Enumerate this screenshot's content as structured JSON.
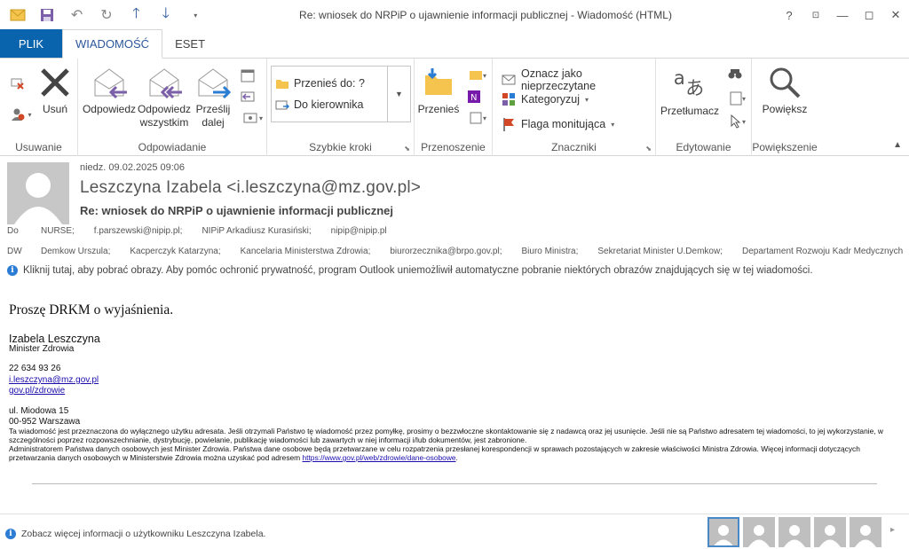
{
  "window": {
    "title": "Re: wniosek do NRPiP o ujawnienie informacji publicznej - Wiadomość (HTML)",
    "help": "?",
    "controls": {
      "minimize": "—",
      "restore": "◻",
      "close": "✕"
    }
  },
  "tabs": [
    {
      "label": "PLIK"
    },
    {
      "label": "WIADOMOŚĆ"
    },
    {
      "label": "ESET"
    }
  ],
  "ribbon": {
    "groups": {
      "delete": {
        "label": "Usuwanie",
        "delete_btn": "Usuń"
      },
      "respond": {
        "label": "Odpowiadanie",
        "reply": "Odpowiedz",
        "reply_all": "Odpowiedz wszystkim",
        "forward": "Prześlij dalej"
      },
      "quick_steps": {
        "label": "Szybkie kroki",
        "item1": "Przenieś do: ?",
        "item2": "Do kierownika"
      },
      "move": {
        "label": "Przenoszenie",
        "move_btn": "Przenieś"
      },
      "tags": {
        "label": "Znaczniki",
        "mark_unread": "Oznacz jako nieprzeczytane",
        "categorize": "Kategoryzuj",
        "follow_up": "Flaga monitująca"
      },
      "editing": {
        "label": "Edytowanie",
        "translate": "Przetłumacz"
      },
      "zoom": {
        "label": "Powiększenie",
        "zoom_btn": "Powiększ"
      }
    }
  },
  "message": {
    "date": "niedz. 09.02.2025 09:06",
    "sender": "Leszczyna Izabela <i.leszczyna@mz.gov.pl>",
    "subject": "Re: wniosek do NRPiP o ujawnienie informacji publicznej",
    "to_label": "Do",
    "to": [
      "NURSE;",
      "f.parszewski@nipip.pl;",
      "NIPiP Arkadiusz Kurasiński;",
      "nipip@nipip.pl"
    ],
    "cc_label": "DW",
    "cc": [
      "Demkow Urszula;",
      "Kacperczyk Katarzyna;",
      "Kancelaria Ministerstwa Zdrowia;",
      "biurorzecznika@brpo.gov.pl;",
      "Biuro Ministra;",
      "Sekretariat Minister U.Demkow;",
      "Departament Rozwoju Kadr Medycznych"
    ],
    "info_bar": "Kliknij tutaj, aby pobrać obrazy. Aby pomóc ochronić prywatność, program Outlook uniemożliwił automatyczne pobranie niektórych obrazów znajdujących się w tej wiadomości."
  },
  "body": {
    "greeting": "Proszę DRKM o wyjaśnienia.",
    "sig_name": "Izabela Leszczyna",
    "sig_role": "Minister Zdrowia",
    "sig_phone": "22 634 93 26",
    "sig_email": "i.leszczyna@mz.gov.pl",
    "sig_web": "gov.pl/zdrowie",
    "sig_addr1": "ul. Miodowa 15",
    "sig_addr2": "00-952 Warszawa",
    "disclaimer1": "Ta wiadomość jest przeznaczona do wyłącznego użytku adresata. Jeśli otrzymali Państwo tę wiadomość przez pomyłkę, prosimy o bezzwłoczne skontaktowanie się z nadawcą oraz jej usunięcie. Jeśli nie są Państwo adresatem tej wiadomości, to jej wykorzystanie, w szczególności poprzez rozpowszechnianie, dystrybucję, powielanie, publikację wiadomości lub zawartych w niej informacji i/lub dokumentów, jest zabronione.",
    "disclaimer2": "Administratorem Państwa danych osobowych jest Minister Zdrowia. Państwa dane osobowe będą przetwarzane w celu rozpatrzenia przesłanej korespondencji w sprawach pozostających w zakresie właściwości Ministra Zdrowia. Więcej informacji dotyczących przetwarzania danych osobowych w Ministerstwie Zdrowia można uzyskać pod adresem",
    "disclaimer_link": "https://www.gov.pl/web/zdrowie/dane-osobowe",
    "disclaimer_end": "."
  },
  "status": {
    "text": "Zobacz więcej informacji o użytkowniku Leszczyna Izabela."
  },
  "colors": {
    "accent": "#2b579a",
    "file_tab": "#0a64ad",
    "link": "#1a0dab"
  }
}
